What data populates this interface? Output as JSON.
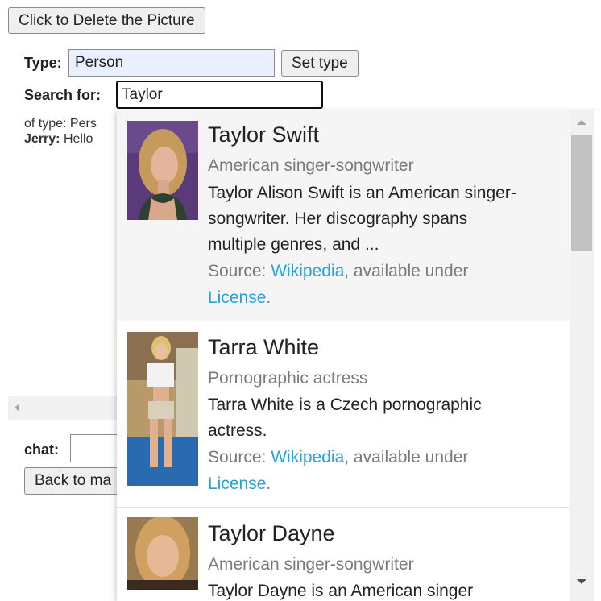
{
  "toolbar": {
    "delete_picture_label": "Click to Delete the Picture"
  },
  "type_row": {
    "label": "Type:",
    "value": "Person",
    "set_type_label": "Set type"
  },
  "search_row": {
    "label": "Search for:",
    "value": "Taylor"
  },
  "log": {
    "type_line": "of type: Pers",
    "speaker": "Jerry:",
    "message": "Hello"
  },
  "chat": {
    "label": "chat:",
    "value": "",
    "back_label": "Back to ma"
  },
  "autocomplete": {
    "results": [
      {
        "name": "Taylor Swift",
        "description": "American singer-songwriter",
        "extract_lines": [
          "Taylor Alison Swift is an American singer-",
          "songwriter. Her discography spans",
          "multiple genres, and ..."
        ],
        "source_prefix": "Source: ",
        "source_link": "Wikipedia",
        "source_suffix": ", available under",
        "license_link": "License",
        "license_suffix": "."
      },
      {
        "name": "Tarra White",
        "description": "Pornographic actress",
        "extract_lines": [
          "Tarra White is a Czech pornographic",
          "actress."
        ],
        "source_prefix": "Source: ",
        "source_link": "Wikipedia",
        "source_suffix": ", available under",
        "license_link": "License",
        "license_suffix": "."
      },
      {
        "name": "Taylor Dayne",
        "description": "American singer-songwriter",
        "extract_lines": [
          "Taylor Dayne is an American singer"
        ]
      }
    ]
  },
  "colors": {
    "link": "#1ea5e0",
    "type_input_bg": "#e8f0fe",
    "highlight_row": "#f5f5f5"
  }
}
